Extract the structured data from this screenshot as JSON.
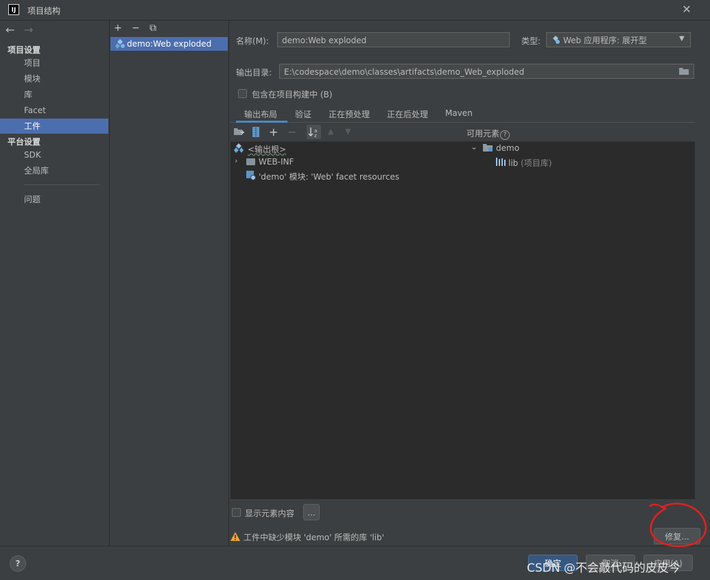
{
  "window": {
    "title": "项目结构",
    "app_icon": "IJ"
  },
  "nav": {
    "back": "←",
    "forward": "→",
    "section_project": "项目设置",
    "project_items": [
      "项目",
      "模块",
      "库",
      "Facet",
      "工件"
    ],
    "selected_item": "工件",
    "section_platform": "平台设置",
    "platform_items": [
      "SDK",
      "全局库"
    ],
    "problems": "问题"
  },
  "list": {
    "add": "+",
    "remove": "−",
    "copy": "⧉",
    "items": [
      "demo:Web exploded"
    ]
  },
  "form": {
    "name_label": "名称(M):",
    "name_value": "demo:Web exploded",
    "type_label": "类型:",
    "type_value": "Web 应用程序: 展开型",
    "output_label": "输出目录:",
    "output_value": "E:\\codespace\\demo\\classes\\artifacts\\demo_Web_exploded",
    "include_in_build": "包含在项目构建中 (B)"
  },
  "tabs": [
    "输出布局",
    "验证",
    "正在预处理",
    "正在后处理",
    "Maven"
  ],
  "active_tab": "输出布局",
  "layout_tree": {
    "root": "<输出根>",
    "items": [
      "WEB-INF",
      "'demo' 模块: 'Web' facet resources"
    ]
  },
  "available": {
    "header": "可用元素",
    "help_glyph": "?",
    "root": "demo",
    "lib_name": "lib",
    "lib_type": "(项目库)"
  },
  "footer": {
    "show_content": "显示元素内容",
    "ellipsis": "...",
    "warning": "工件中缺少模块 'demo' 所需的库 'lib'",
    "fix_button": "修复...",
    "ok": "确定",
    "cancel": "取消",
    "apply": "应用(A)",
    "help": "?"
  },
  "watermark": "CSDN @不会敲代码的皮皮今",
  "colors": {
    "accent": "#4b6eaf",
    "warning": "#f0a732",
    "annotation": "#e02020"
  }
}
